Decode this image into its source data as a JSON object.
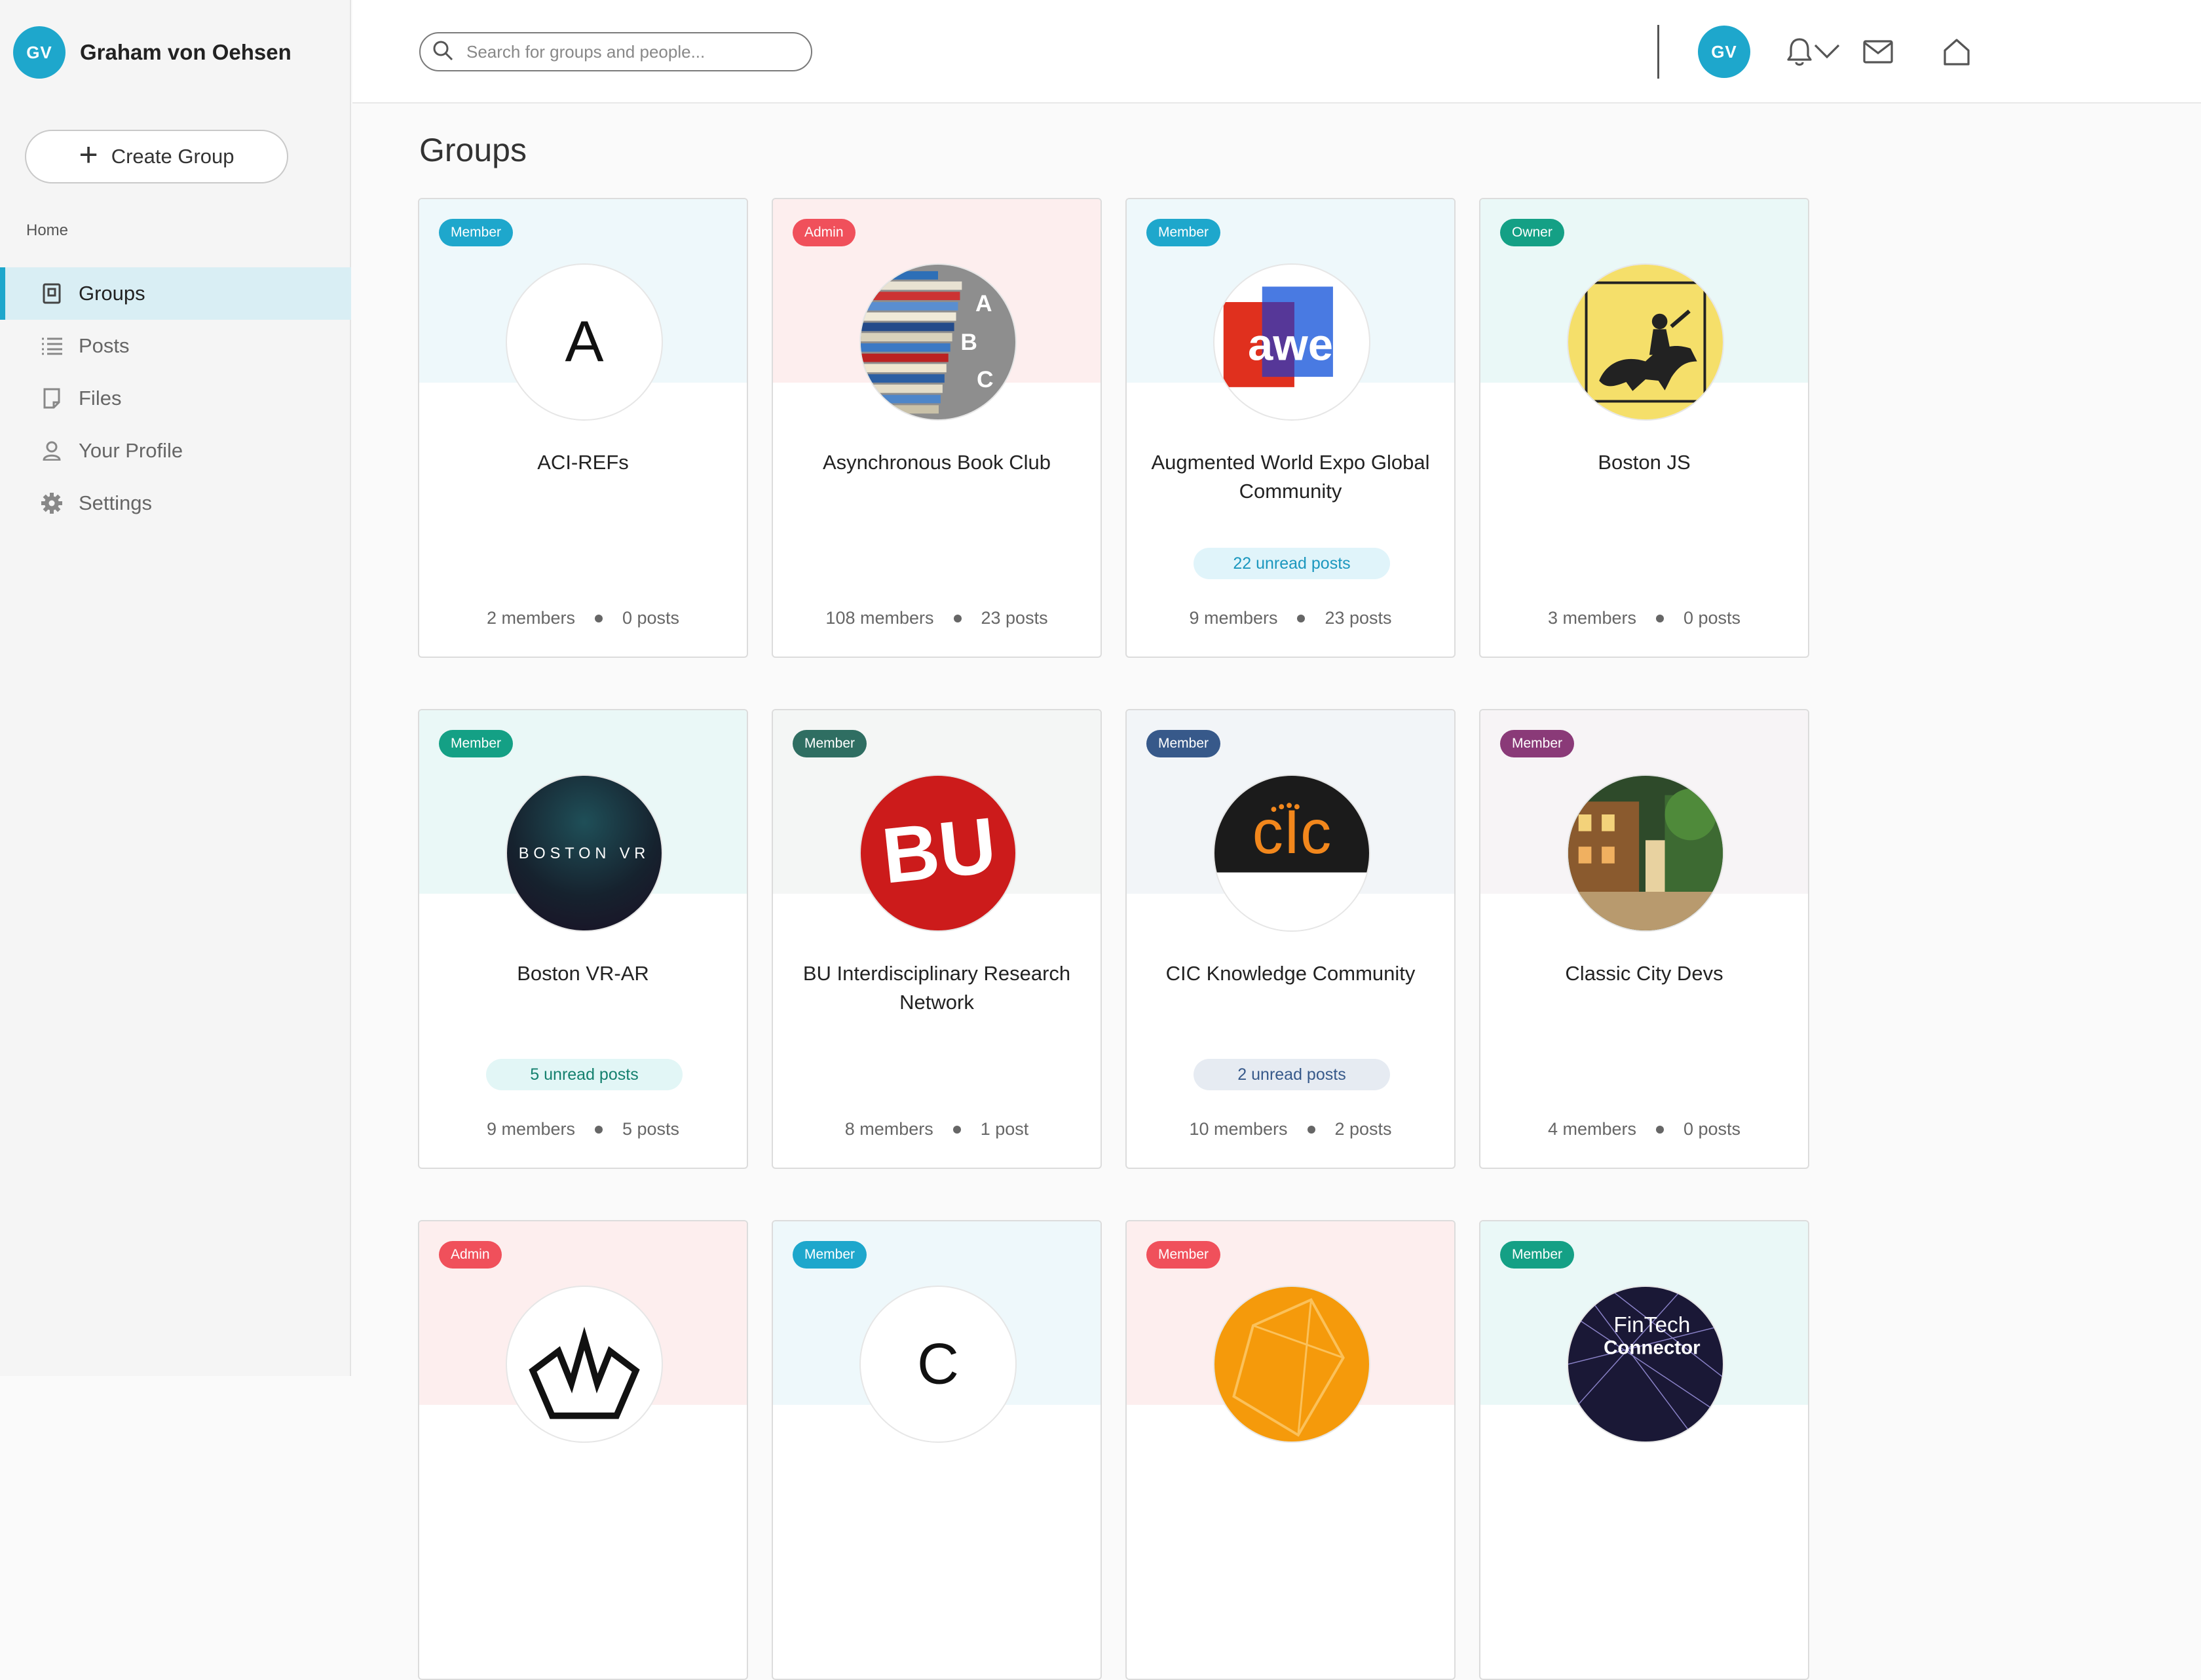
{
  "user": {
    "initials": "GV",
    "name": "Graham von Oehsen"
  },
  "sidebar": {
    "create_group_label": "Create Group",
    "home_label": "Home",
    "items": [
      {
        "label": "Groups",
        "icon": "groups-icon",
        "active": true
      },
      {
        "label": "Posts",
        "icon": "list-icon",
        "active": false
      },
      {
        "label": "Files",
        "icon": "file-icon",
        "active": false
      },
      {
        "label": "Your Profile",
        "icon": "person-icon",
        "active": false
      },
      {
        "label": "Settings",
        "icon": "gear-icon",
        "active": false
      }
    ]
  },
  "header": {
    "search_placeholder": "Search for groups and people...",
    "icons": [
      "bell-icon",
      "mail-icon",
      "home-icon"
    ],
    "avatar_initials": "GV"
  },
  "main": {
    "title": "Groups",
    "cards": [
      {
        "role": "Member",
        "role_color": "#1ea7cc",
        "band": "#eef8fb",
        "name": "ACI-REFs",
        "members": "2 members",
        "posts": "0 posts",
        "unread": "",
        "logo": "letter-a"
      },
      {
        "role": "Admin",
        "role_color": "#f0505b",
        "band": "#fdeeee",
        "name": "Asynchronous Book Club",
        "members": "108 members",
        "posts": "23 posts",
        "unread": "",
        "logo": "books"
      },
      {
        "role": "Member",
        "role_color": "#1ea7cc",
        "band": "#eef8fb",
        "name": "Augmented World Expo Global Community",
        "members": "9 members",
        "posts": "23 posts",
        "unread": "22 unread posts",
        "unread_bg": "#e0f4fa",
        "unread_color": "#1b97be",
        "logo": "awe"
      },
      {
        "role": "Owner",
        "role_color": "#14a085",
        "band": "#eaf8f7",
        "name": "Boston JS",
        "members": "3 members",
        "posts": "0 posts",
        "unread": "",
        "logo": "bostonjs"
      },
      {
        "role": "Member",
        "role_color": "#14a085",
        "band": "#eaf8f7",
        "name": "Boston VR-AR",
        "members": "9 members",
        "posts": "5 posts",
        "unread": "5 unread posts",
        "unread_bg": "#e2f6f6",
        "unread_color": "#14806e",
        "logo": "bostonvr",
        "logo_text": "BOSTON VR"
      },
      {
        "role": "Member",
        "role_color": "#2f6e62",
        "band": "#f4f6f5",
        "name": "BU Interdisciplinary Research Network",
        "members": "8 members",
        "posts": "1 post",
        "unread": "",
        "logo": "bu",
        "logo_text": "BU"
      },
      {
        "role": "Member",
        "role_color": "#37598a",
        "band": "#f2f5f8",
        "name": "CIC Knowledge Community",
        "members": "10 members",
        "posts": "2 posts",
        "unread": "2 unread posts",
        "unread_bg": "#e6ebf2",
        "unread_color": "#37598a",
        "logo": "cic",
        "logo_text": "CIC"
      },
      {
        "role": "Member",
        "role_color": "#8a3a78",
        "band": "#f7f4f6",
        "name": "Classic City Devs",
        "members": "4 members",
        "posts": "0 posts",
        "unread": "",
        "logo": "city"
      },
      {
        "role": "Admin",
        "role_color": "#f0505b",
        "band": "#fdeeee",
        "name": "",
        "members": "",
        "posts": "",
        "unread": "",
        "logo": "boat"
      },
      {
        "role": "Member",
        "role_color": "#1ea7cc",
        "band": "#eef8fb",
        "name": "",
        "members": "",
        "posts": "",
        "unread": "",
        "logo": "letter-c"
      },
      {
        "role": "Member",
        "role_color": "#f0505b",
        "band": "#fdeeee",
        "name": "",
        "members": "",
        "posts": "",
        "unread": "",
        "logo": "orange"
      },
      {
        "role": "Member",
        "role_color": "#14a085",
        "band": "#eaf8f7",
        "name": "",
        "members": "",
        "posts": "",
        "unread": "",
        "logo": "fintech",
        "logo_text": "FinTech Connector"
      }
    ]
  }
}
